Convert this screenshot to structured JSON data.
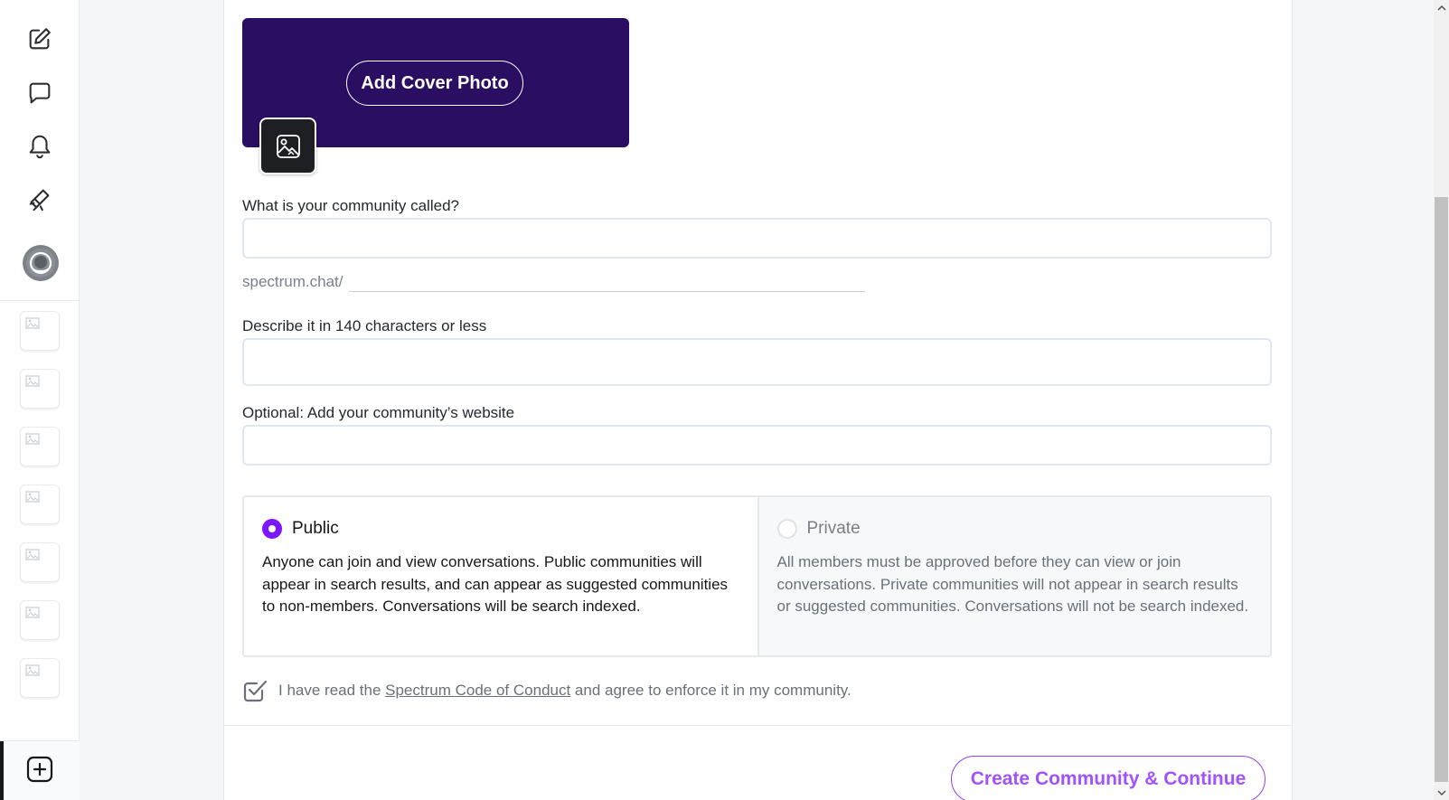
{
  "nav": {
    "icons": [
      "compose-icon",
      "messages-icon",
      "notifications-icon",
      "explore-icon"
    ],
    "community_count": 7
  },
  "cover": {
    "add_cover_label": "Add Cover Photo"
  },
  "form": {
    "name_label": "What is your community called?",
    "name_value": "",
    "slug_prefix": "spectrum.chat/",
    "slug_value": "",
    "description_label": "Describe it in 140 characters or less",
    "description_value": "",
    "website_label": "Optional: Add your community’s website",
    "website_value": ""
  },
  "privacy": {
    "public_label": "Public",
    "public_desc": "Anyone can join and view conversations. Public communities will appear in search results, and can appear as suggested communities to non-members. Conversations will be search indexed.",
    "private_label": "Private",
    "private_desc": "All members must be approved before they can view or join conversations. Private communities will not appear in search results or suggested communities. Conversations will not be search indexed.",
    "selected": "public"
  },
  "agreement": {
    "prefix": "I have read the ",
    "link": "Spectrum Code of Conduct",
    "suffix": " and agree to enforce it in my community.",
    "checked": true
  },
  "actions": {
    "submit_label": "Create Community & Continue"
  },
  "colors": {
    "cover_bg": "#2a0e62",
    "accent": "#7b16ff",
    "submit_text": "#a251ff"
  }
}
